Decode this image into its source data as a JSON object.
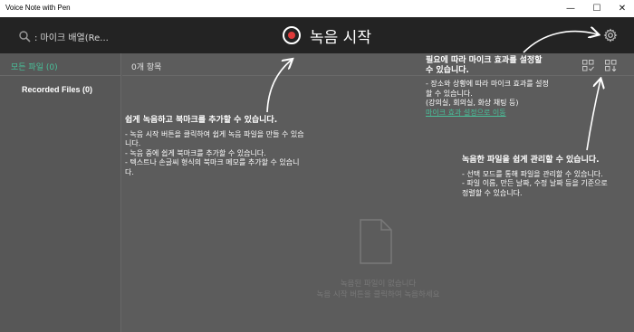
{
  "window": {
    "title": "Voice Note with Pen",
    "minimize_glyph": "—",
    "maximize_glyph": "☐",
    "close_glyph": "✕"
  },
  "header": {
    "search_placeholder": ": 마이크 배열(Re...",
    "record_label": "녹음 시작",
    "accent_record": "#e03b3b"
  },
  "sidebar": {
    "all_files": "모든 파일 (0)",
    "recorded_files": "Recorded Files (0)"
  },
  "main": {
    "item_count": "0개 항목",
    "empty_title": "녹음된 파일이 없습니다",
    "empty_desc": "녹음 시작 버튼을 클릭하여 녹음하세요"
  },
  "tips": {
    "record": {
      "title": "쉽게 녹음하고 북마크를 추가할 수 있습니다.",
      "lines": [
        "- 녹음 시작 버튼을 클릭하여 쉽게 녹음 파일을 만들 수 있습",
        "니다.",
        "- 녹음 중에 쉽게 북마크를 추가할 수 있습니다.",
        "- 텍스트나 손글씨 형식의 북마크 메모를 추가할 수 있습니",
        "다."
      ]
    },
    "mic": {
      "title_1": "필요에 따라 마이크 효과를 설정할",
      "title_2": "수 있습니다.",
      "lines": [
        "- 장소와 상황에 따라 마이크 효과를 설정",
        "할 수 있습니다.",
        "(강의실, 회의실, 화상 채팅 등)"
      ],
      "link": "마이크 효과 설정으로 이동"
    },
    "manage": {
      "title": "녹음한 파일을 쉽게 관리할 수 있습니다.",
      "lines": [
        "- 선택 모드를 통해 파일을 관리할 수 있습니다.",
        "- 파일 이름, 만든 날짜, 수정 날짜 등을 기준으로",
        "정렬할 수 있습니다."
      ]
    }
  },
  "icons": {
    "search": "search-icon",
    "record": "record-icon",
    "settings": "gear-icon",
    "select": "select-mode-icon",
    "sort": "sort-icon",
    "empty": "empty-file-icon"
  }
}
